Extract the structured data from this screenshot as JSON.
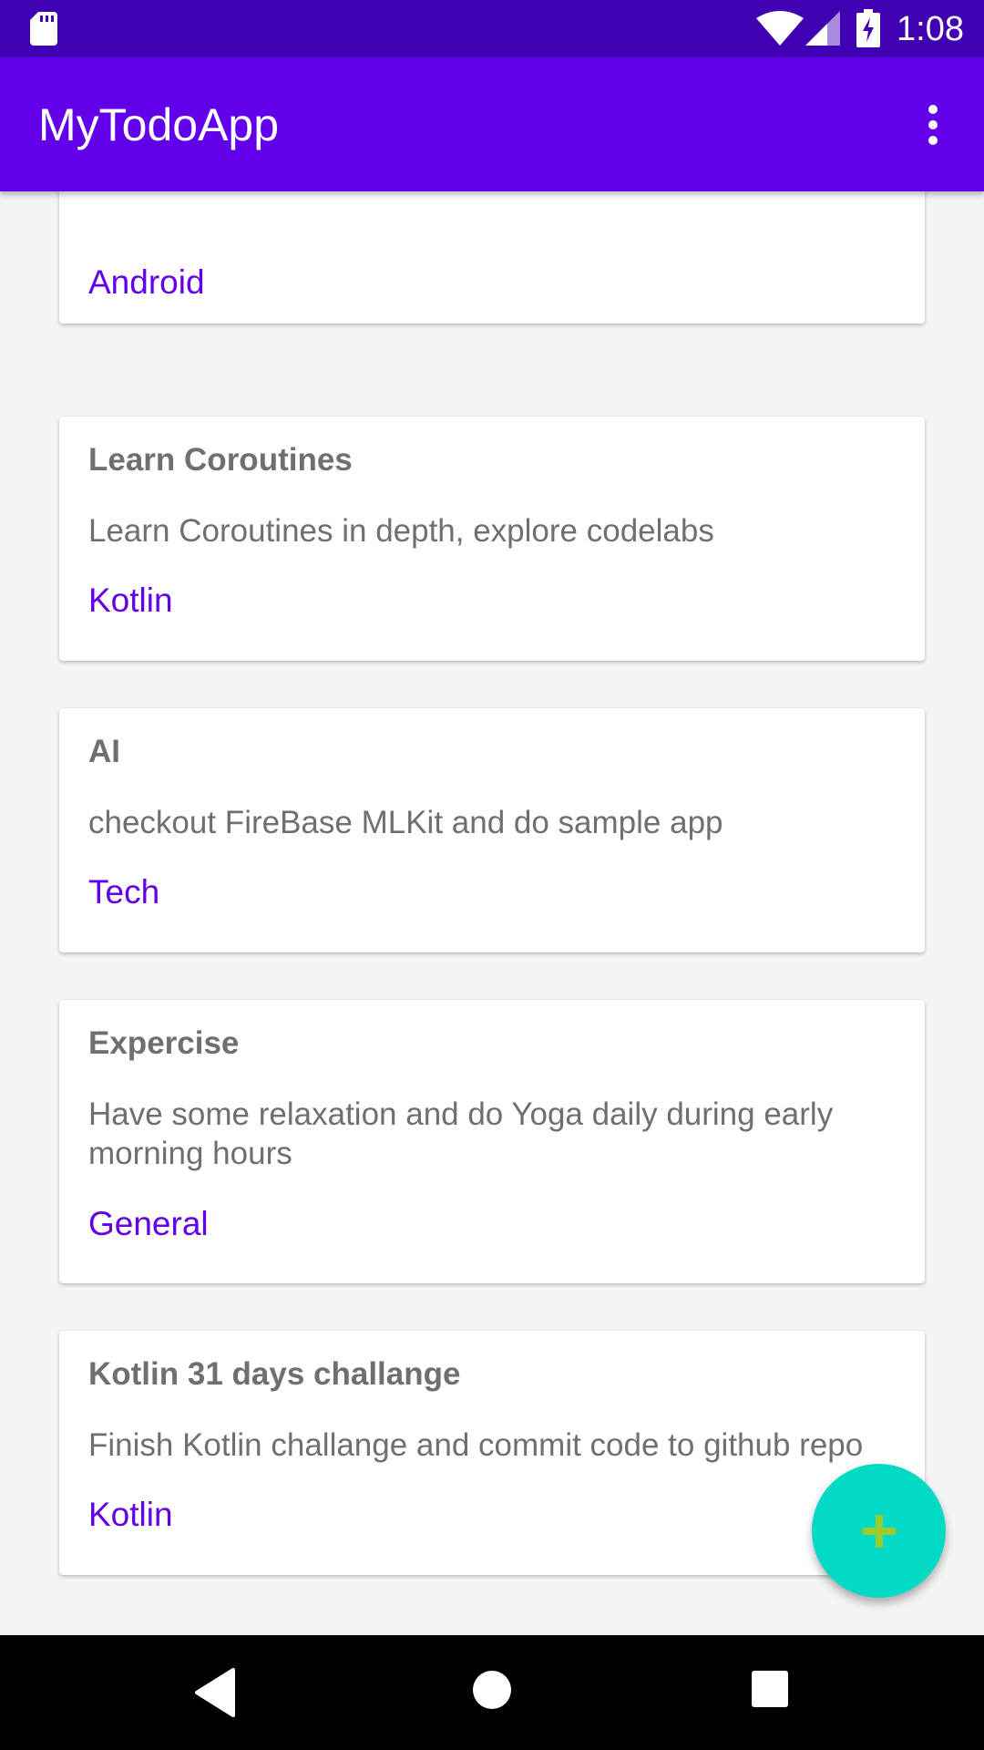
{
  "status_bar": {
    "time": "1:08",
    "icons": [
      "sd-card-icon",
      "wifi-icon",
      "cell-signal-icon",
      "battery-charging-icon"
    ]
  },
  "app_bar": {
    "title": "MyTodoApp",
    "menu_icon": "more-vert-icon"
  },
  "todos": [
    {
      "title": "",
      "description": "",
      "category": "Android"
    },
    {
      "title": "Learn Coroutines",
      "description": "Learn Coroutines in depth, explore codelabs",
      "category": "Kotlin"
    },
    {
      "title": "AI",
      "description": "checkout FireBase MLKit and do sample app",
      "category": "Tech"
    },
    {
      "title": "Expercise",
      "description": "Have some relaxation and do Yoga daily during early morning hours",
      "category": "General"
    },
    {
      "title": "Kotlin 31 days challange",
      "description": "Finish Kotlin challange and commit code to github repo",
      "category": "Kotlin"
    }
  ],
  "fab": {
    "icon": "plus-icon"
  },
  "nav_bar": {
    "icons": [
      "back-icon",
      "home-icon",
      "recents-icon"
    ]
  },
  "colors": {
    "status_bar": "#4000b4",
    "primary": "#6200ea",
    "accent": "#03dac5",
    "text_secondary": "#6f6f6f"
  }
}
